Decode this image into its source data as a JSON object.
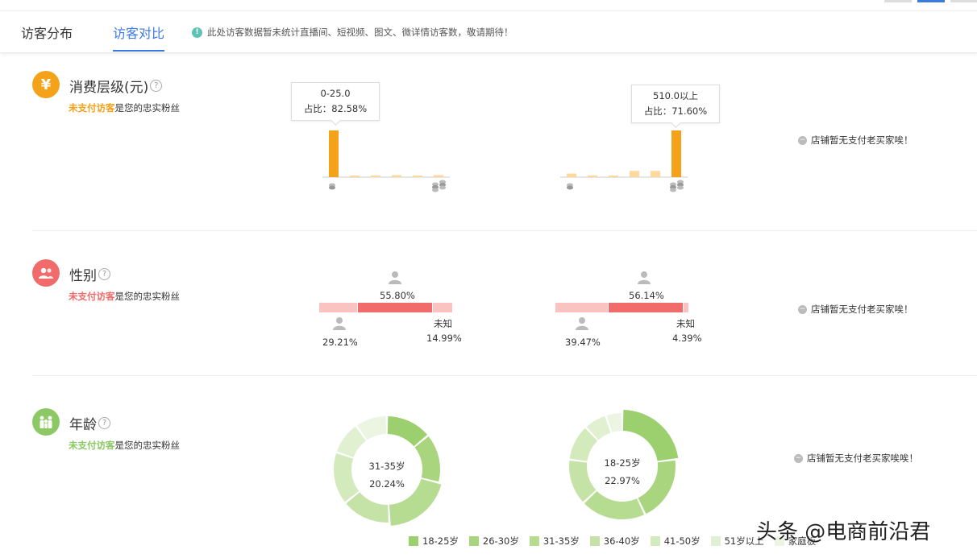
{
  "tabs": [
    {
      "label": "访客分布",
      "active": false
    },
    {
      "label": "访客对比",
      "active": true
    }
  ],
  "notice": "此处访客数据暂未统计直播间、短视频、图文、微详情访客数，敬请期待！",
  "sections": {
    "spending": {
      "title": "消费层级(元)",
      "sub_highlight": "未支付访客",
      "sub_rest": "是您的忠实粉丝",
      "icon_color": "#f5a21b",
      "chart_data": [
        {
          "type": "bar",
          "categories": [
            "1",
            "2",
            "3",
            "4",
            "5",
            "6"
          ],
          "values": [
            82.58,
            1.5,
            2.5,
            3.5,
            2.8,
            3.5
          ],
          "tooltip_range": "0-25.0",
          "tooltip_share": "占比：82.58%"
        },
        {
          "type": "bar",
          "categories": [
            "1",
            "2",
            "3",
            "4",
            "5",
            "6"
          ],
          "values": [
            5.5,
            1.5,
            2.0,
            9.5,
            9.5,
            71.6
          ],
          "tooltip_range": "510.0以上",
          "tooltip_share": "占比：71.60%"
        }
      ],
      "empty_msg": "店铺暂无支付老买家唉！"
    },
    "gender": {
      "title": "性别",
      "sub_highlight": "未支付访客",
      "sub_rest": "是您的忠实粉丝",
      "icon_color": "#f26b6b",
      "left": {
        "male": "29.21%",
        "female": "55.80%",
        "unknown_label": "未知",
        "unknown": "14.99%",
        "male_val": 29.21,
        "female_val": 55.8,
        "unknown_val": 14.99
      },
      "right": {
        "male": "39.47%",
        "female": "56.14%",
        "unknown_label": "未知",
        "unknown": "4.39%",
        "male_val": 39.47,
        "female_val": 56.14,
        "unknown_val": 4.39
      },
      "empty_msg": "店铺暂无支付老买家唉！"
    },
    "age": {
      "title": "年龄",
      "sub_highlight": "未支付访客",
      "sub_rest": "是您的忠实粉丝",
      "icon_color": "#8cc864",
      "left_center_label": "31-35岁",
      "left_center_value": "20.24%",
      "right_center_label": "18-25岁",
      "right_center_value": "22.97%",
      "empty_msg": "店铺暂无支付老买家唉唉！",
      "chart_data": [
        {
          "type": "pie",
          "categories": [
            "18-25岁",
            "26-30岁",
            "31-35岁",
            "36-40岁",
            "41-50岁",
            "51岁以上",
            "家庭板"
          ],
          "values": [
            14,
            15,
            20.24,
            15,
            16,
            10,
            9.76
          ]
        },
        {
          "type": "pie",
          "categories": [
            "18-25岁",
            "26-30岁",
            "31-35岁",
            "36-40岁",
            "41-50岁",
            "51岁以上",
            "家庭板"
          ],
          "values": [
            22.97,
            20,
            20,
            14,
            11,
            7,
            5.03
          ]
        }
      ],
      "legend": [
        {
          "label": "18-25岁",
          "color": "#9ccf6e"
        },
        {
          "label": "26-30岁",
          "color": "#a8d57e"
        },
        {
          "label": "31-35岁",
          "color": "#b6dc91"
        },
        {
          "label": "36-40岁",
          "color": "#c5e3a7"
        },
        {
          "label": "41-50岁",
          "color": "#d3eabd"
        },
        {
          "label": "51岁以上",
          "color": "#e0f0d0"
        },
        {
          "label": "家庭板",
          "color": "#ebf5e2"
        }
      ]
    }
  },
  "watermark": "头条 @电商前沿君"
}
